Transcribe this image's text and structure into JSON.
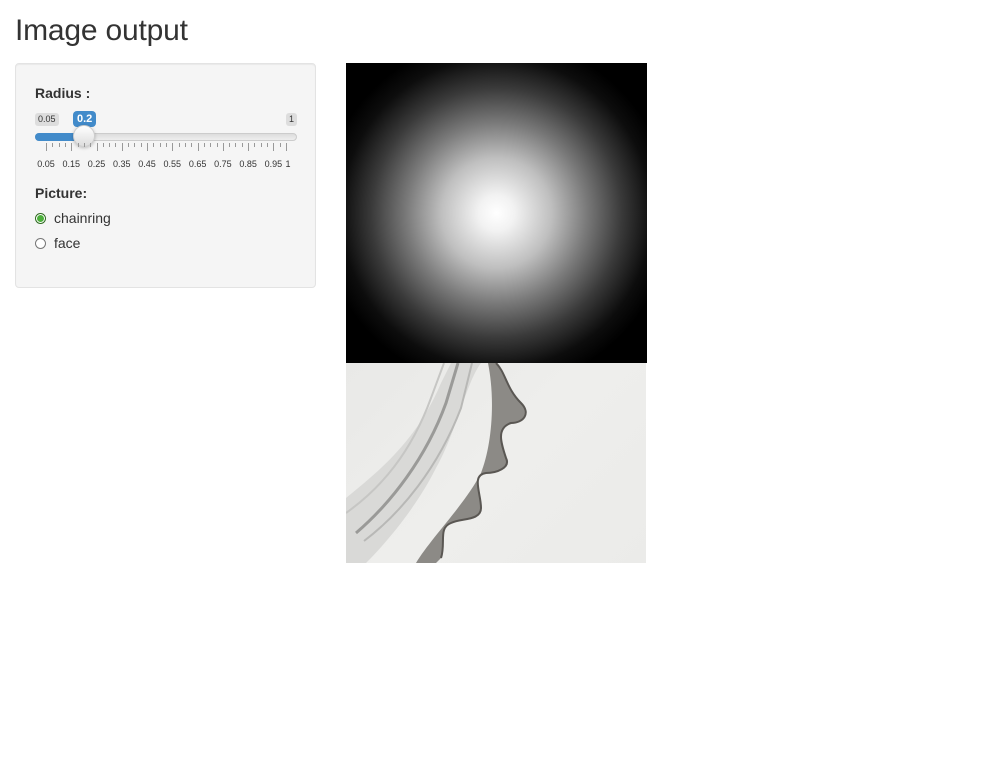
{
  "page": {
    "title": "Image output"
  },
  "sidebar": {
    "radius": {
      "label": "Radius :",
      "min": 0.05,
      "max": 1,
      "value": 0.2,
      "min_text": "0.05",
      "max_text": "1",
      "value_text": "0.2",
      "ticks": [
        "0.05",
        "0.15",
        "0.25",
        "0.35",
        "0.45",
        "0.55",
        "0.65",
        "0.75",
        "0.85",
        "0.95",
        "1"
      ],
      "accent_color": "#428bca"
    },
    "picture": {
      "label": "Picture:",
      "options": [
        {
          "label": "chainring",
          "selected": true
        },
        {
          "label": "face",
          "selected": false
        }
      ],
      "checked_color": "#4caf3b"
    }
  },
  "main": {
    "plot_image": "radial-gradient-spot",
    "photo_image": "chainring-photo"
  }
}
